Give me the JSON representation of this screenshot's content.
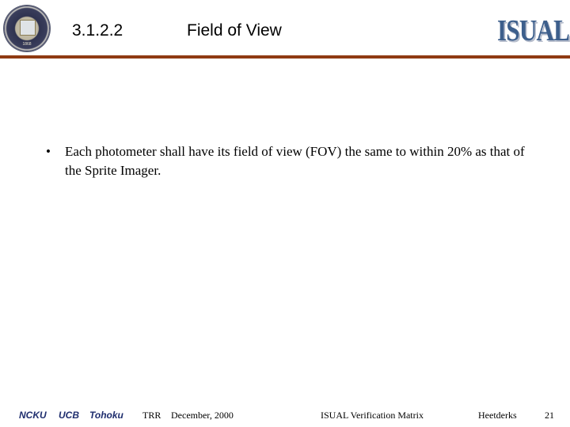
{
  "header": {
    "section_number": "3.1.2.2",
    "title": "Field of View",
    "logo_text": "ISUAL",
    "seal_year": "1868",
    "rule_color": "#8f3a12"
  },
  "body": {
    "bullets": [
      {
        "text": "Each photometer shall have its field of view (FOV) the same to within 20% as that of the Sprite Imager."
      }
    ]
  },
  "footer": {
    "institutions": [
      "NCKU",
      "UCB",
      "Tohoku"
    ],
    "review": "TRR",
    "date": "December, 2000",
    "document": "ISUAL Verification Matrix",
    "author": "Heetderks",
    "page_number": "21"
  }
}
